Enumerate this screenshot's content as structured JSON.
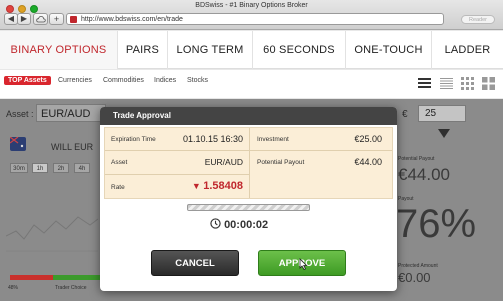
{
  "browser": {
    "window_title": "BDSwiss - #1 Binary Options Broker",
    "url": "http://www.bdswiss.com/en/trade",
    "reader_label": "Reader",
    "nav_back": "◀",
    "nav_forward": "▶"
  },
  "nav": {
    "tabs": [
      {
        "label": "BINARY OPTIONS",
        "active": true
      },
      {
        "label": "PAIRS"
      },
      {
        "label": "LONG TERM"
      },
      {
        "label": "60 SECONDS"
      },
      {
        "label": "ONE-TOUCH"
      },
      {
        "label": "LADDER"
      }
    ]
  },
  "subnav": {
    "items": [
      "TOP Assets",
      "Currencies",
      "Commodities",
      "Indices",
      "Stocks"
    ],
    "accent": "#d9262e"
  },
  "background": {
    "asset_label": "Asset :",
    "asset_value": "EUR/AUD",
    "will_text": "WILL EUR",
    "time_buttons": [
      "30m",
      "1h",
      "2h",
      "4h"
    ],
    "euro_sign": "€",
    "amount_value": "25",
    "potential_payout_label": "Potential Payout",
    "payout_value": "€44.00",
    "payout_label": "Payout",
    "payout_percent": "76%",
    "protected_amount_label": "Protected Amount",
    "protected_value": "€0.00",
    "percent_48": "48%",
    "trader_choice": "Trader Choice"
  },
  "modal": {
    "title": "Trade Approval",
    "expiration_label": "Expiration Time",
    "expiration_value": "01.10.15 16:30",
    "asset_label": "Asset",
    "asset_value": "EUR/AUD",
    "rate_label": "Rate",
    "rate_value": "1.58408",
    "rate_color": "#c0272d",
    "investment_label": "Investment",
    "investment_value": "€25.00",
    "potential_payout_label": "Potential Payout",
    "potential_payout_value": "€44.00",
    "timer_value": "00:00:02",
    "cancel_label": "CANCEL",
    "approve_label": "APPROVE"
  }
}
